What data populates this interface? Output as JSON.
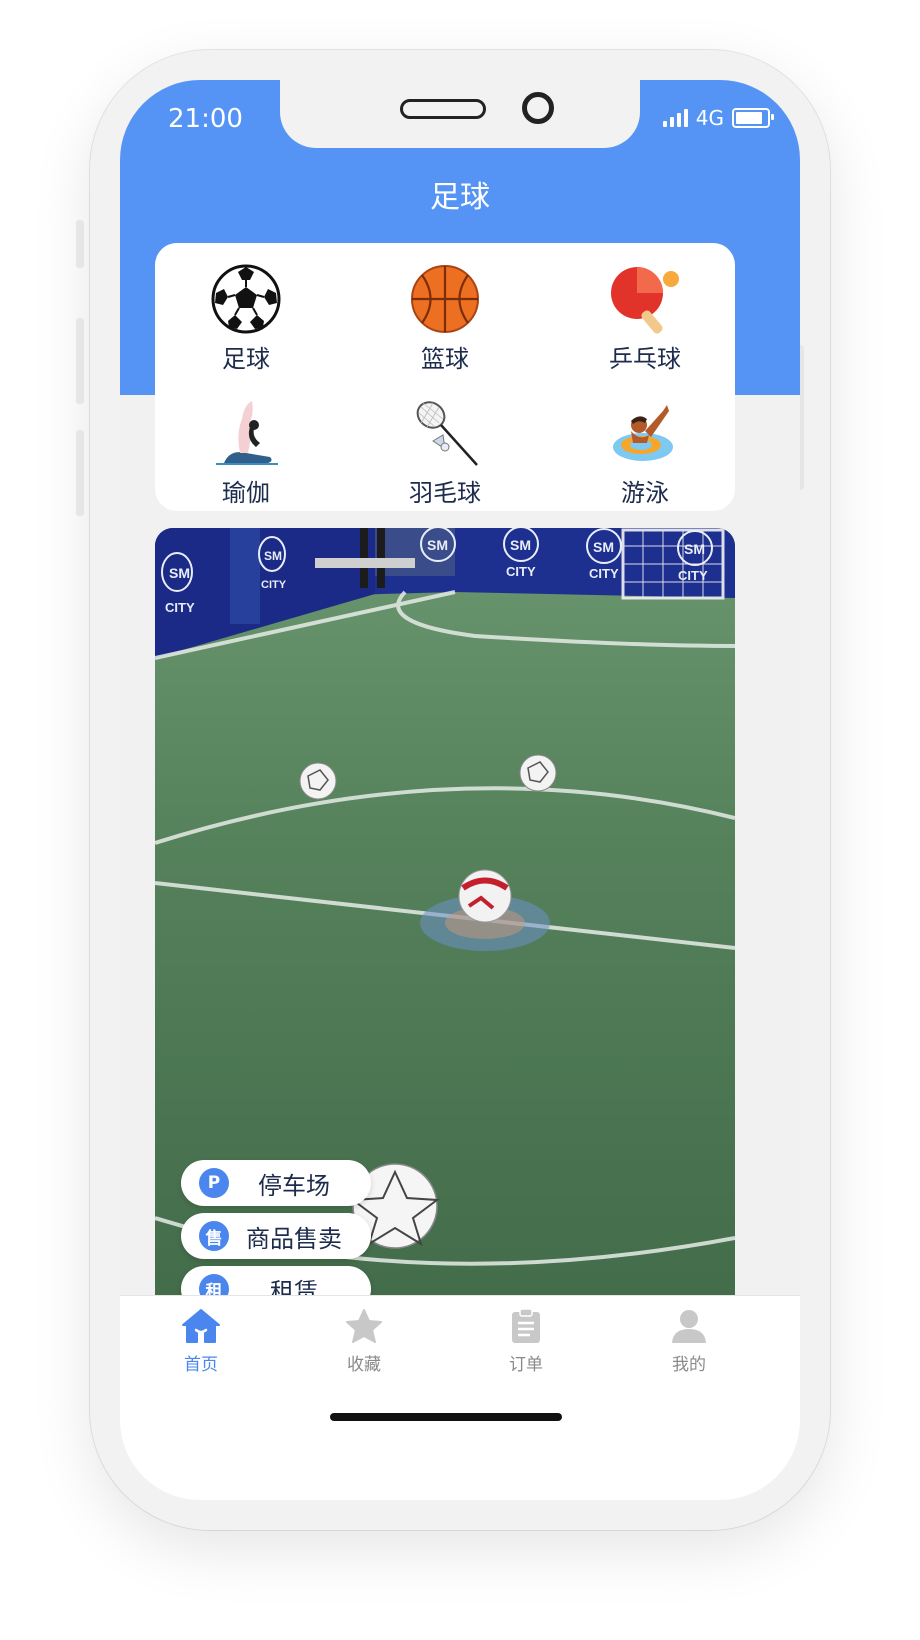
{
  "status_bar": {
    "time": "21:00",
    "network": "4G"
  },
  "header": {
    "title": "足球"
  },
  "categories": [
    {
      "label": "足球",
      "icon": "soccer-ball-icon"
    },
    {
      "label": "篮球",
      "icon": "basketball-icon"
    },
    {
      "label": "乒乓球",
      "icon": "ping-pong-icon"
    },
    {
      "label": "瑜伽",
      "icon": "yoga-icon"
    },
    {
      "label": "羽毛球",
      "icon": "badminton-icon"
    },
    {
      "label": "游泳",
      "icon": "swimming-icon"
    }
  ],
  "banner": {
    "wall_text_top": "SM",
    "wall_text_bottom": "CITY"
  },
  "quick_actions": [
    {
      "label": "停车场",
      "icon_text": "P",
      "icon": "parking-icon"
    },
    {
      "label": "商品售卖",
      "icon_text": "售",
      "icon": "sale-icon"
    },
    {
      "label": "租赁",
      "icon_text": "租",
      "icon": "rent-icon"
    }
  ],
  "tabbar": [
    {
      "label": "首页",
      "icon": "home-icon",
      "active": true
    },
    {
      "label": "收藏",
      "icon": "star-icon",
      "active": false
    },
    {
      "label": "订单",
      "icon": "clipboard-icon",
      "active": false
    },
    {
      "label": "我的",
      "icon": "user-icon",
      "active": false
    }
  ],
  "colors": {
    "primary": "#5594f4",
    "active_tab": "#4a86ee",
    "inactive_tab": "#c8c8c8",
    "text": "#1d2b4d"
  }
}
